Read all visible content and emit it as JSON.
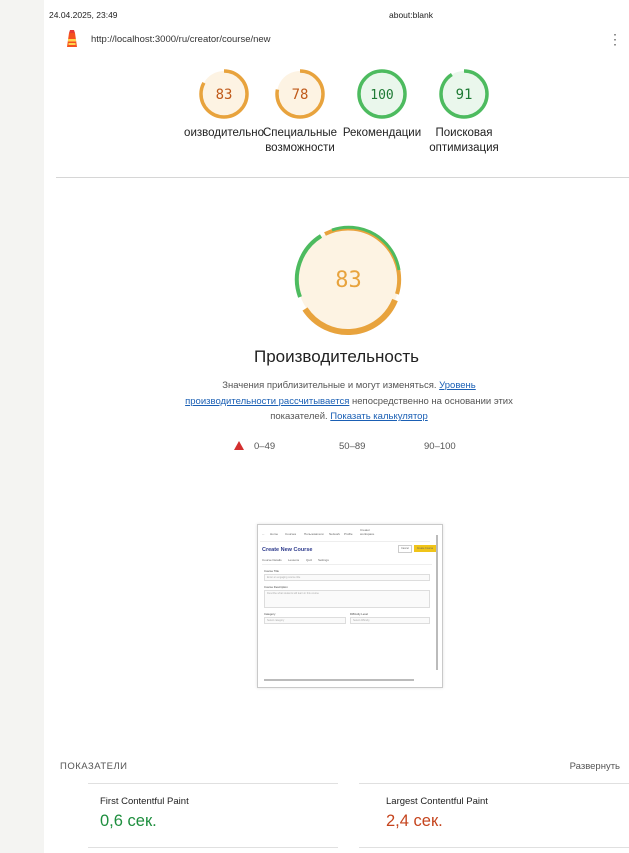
{
  "print_header": {
    "date": "24.04.2025, 23:49",
    "title": "about:blank"
  },
  "url_bar": {
    "url": "http://localhost:3000/ru/creator/course/new",
    "menu_icon": "kebab-menu-icon",
    "logo_icon": "lighthouse-icon"
  },
  "summary_gauges": [
    {
      "score": "83",
      "label": "оизводительно",
      "color": "#e8a33d"
    },
    {
      "score": "78",
      "label": "Специальные\nвозможности",
      "color": "#e8a33d"
    },
    {
      "score": "100",
      "label": "Рекомендации",
      "color": "#4dbb5f"
    },
    {
      "score": "91",
      "label": "Поисковая\nоптимизация",
      "color": "#4dbb5f"
    }
  ],
  "performance": {
    "score": "83",
    "score_fraction": 0.83,
    "title": "Производительность",
    "desc_text_1": "Значения приблизительные и могут изменяться. ",
    "desc_link_1": "Уровень производительности рассчитывается",
    "desc_text_2": " непосредственно на основании этих показателей. ",
    "desc_link_2": "Показать калькулятор",
    "legend": {
      "fail": "0–49",
      "average": "50–89",
      "pass": "90–100"
    }
  },
  "thumbnail": {
    "nav": [
      "Home",
      "Courses",
      "Пользователи",
      "Network",
      "Profile",
      "Creator workspace"
    ],
    "heading": "Create New Course",
    "cancel": "Cancel",
    "create": "Create Course",
    "tabs": [
      "Course Details",
      "Lessons",
      "Quiz",
      "Settings"
    ],
    "fields": {
      "title_label": "Course Title",
      "title_placeholder": "Enter an engaging course title",
      "desc_label": "Course Description",
      "desc_placeholder": "Describe what students will learn in this course",
      "category_label": "Category",
      "category_value": "Select category",
      "difficulty_label": "Difficulty Level",
      "difficulty_value": "Select difficulty"
    }
  },
  "metrics": {
    "header": "ПОКАЗАТЕЛИ",
    "expand": "Развернуть",
    "items": [
      {
        "name": "First Contentful Paint",
        "value": "0,6 сек.",
        "color": "#1e8e3e"
      },
      {
        "name": "Largest Contentful Paint",
        "value": "2,4 сек.",
        "color": "#c5441d"
      }
    ]
  },
  "colors": {
    "pass": "#4dbb5f",
    "average": "#e8a33d",
    "fail": "#d32f2f",
    "link": "#1a5fb4"
  }
}
